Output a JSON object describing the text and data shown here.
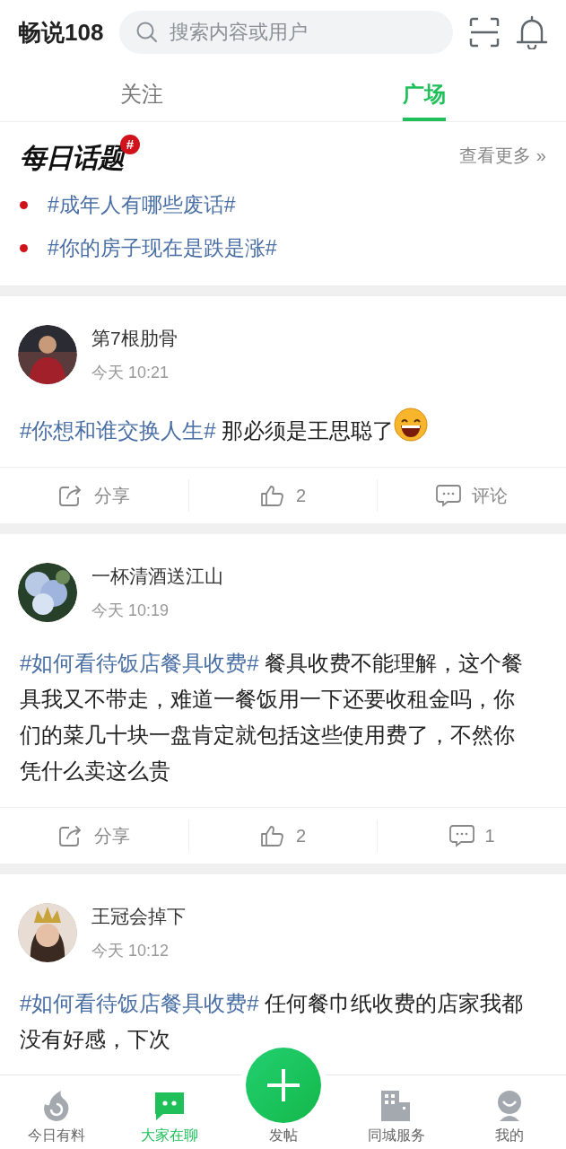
{
  "header": {
    "title": "畅说108",
    "search": {
      "placeholder": "搜索内容或用户"
    }
  },
  "tabs": [
    {
      "label": "关注",
      "selected": false
    },
    {
      "label": "广场",
      "selected": true
    }
  ],
  "daily_topics": {
    "logo": "每日话题",
    "badge": "#",
    "more": "查看更多 »",
    "topics": [
      {
        "text": "#成年人有哪些废话#",
        "color": "#d0121b"
      },
      {
        "text": "#你的房子现在是跌是涨#",
        "color": "#d0121b"
      }
    ]
  },
  "posts": [
    {
      "author": "第7根肋骨",
      "time": "今天 10:21",
      "topic": "#你想和谁交换人生#",
      "text": "那必须是王思聪了",
      "emoji": true,
      "share": "分享",
      "likes": "2",
      "comments": "评论"
    },
    {
      "author": "一杯清酒送江山",
      "time": "今天 10:19",
      "topic": "#如何看待饭店餐具收费#",
      "text": "餐具收费不能理解，这个餐具我又不带走，难道一餐饭用一下还要收租金吗，你们的菜几十块一盘肯定就包括这些使用费了，不然你凭什么卖这么贵",
      "emoji": false,
      "share": "分享",
      "likes": "2",
      "comments": "1"
    },
    {
      "author": "王冠会掉下",
      "time": "今天 10:12",
      "topic": "#如何看待饭店餐具收费#",
      "text": "任何餐巾纸收费的店家我都没有好感，下次",
      "emoji": false
    }
  ],
  "bottom_nav": [
    {
      "label": "今日有料",
      "kind": "tab",
      "selected": false
    },
    {
      "label": "大家在聊",
      "kind": "tab",
      "selected": true
    },
    {
      "label": "发帖",
      "kind": "fab",
      "selected": false
    },
    {
      "label": "同城服务",
      "kind": "tab",
      "selected": false
    },
    {
      "label": "我的",
      "kind": "tab",
      "selected": false
    }
  ]
}
